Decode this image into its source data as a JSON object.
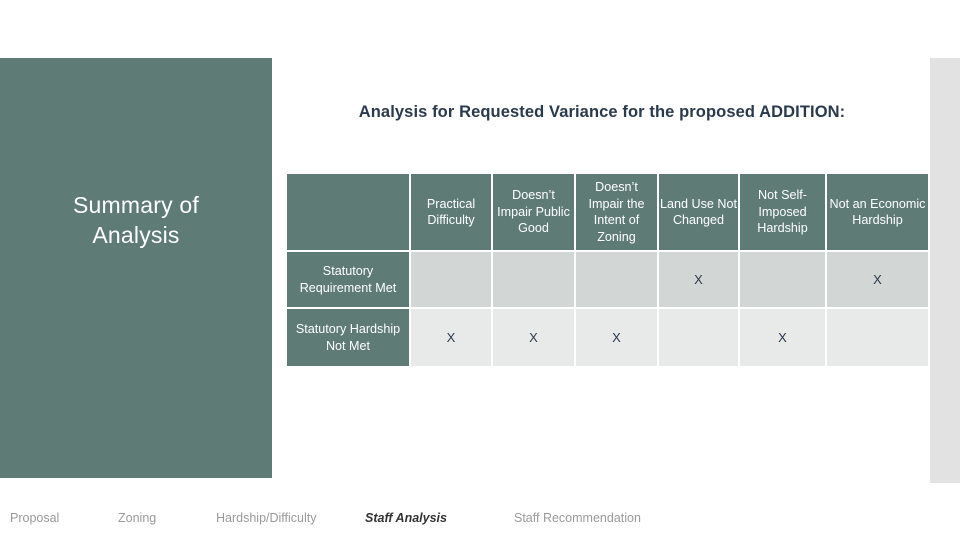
{
  "slide": {
    "title": "Analysis for Requested Variance for the proposed ADDITION:",
    "sidebar_title": "Summary of\nAnalysis",
    "accent_color": "#5F7B76",
    "title_color": "#2A3A4E",
    "row_met_cell_color": "#D2D6D5",
    "row_notmet_cell_color": "#E8EAE9",
    "right_bar_color": "#E2E2E2"
  },
  "table": {
    "corner_label": "",
    "columns": [
      "Practical Difficulty",
      "Doesn’t Impair Public Good",
      "Doesn’t Impair the Intent of Zoning",
      "Land Use Not Changed",
      "Not Self-Imposed Hardship",
      "Not an Economic Hardship"
    ],
    "rows": [
      {
        "label": "Statutory Requirement Met",
        "cells": [
          "",
          "",
          "",
          "X",
          "",
          "X"
        ]
      },
      {
        "label": "Statutory Hardship Not Met",
        "cells": [
          "X",
          "X",
          "X",
          "",
          "X",
          ""
        ]
      }
    ]
  },
  "bottom_nav": {
    "items": [
      {
        "label": "Proposal",
        "active": false
      },
      {
        "label": "Zoning",
        "active": false
      },
      {
        "label": "Hardship/Difficulty",
        "active": false
      },
      {
        "label": "Staff Analysis",
        "active": true
      },
      {
        "label": "Staff Recommendation",
        "active": false
      }
    ]
  }
}
